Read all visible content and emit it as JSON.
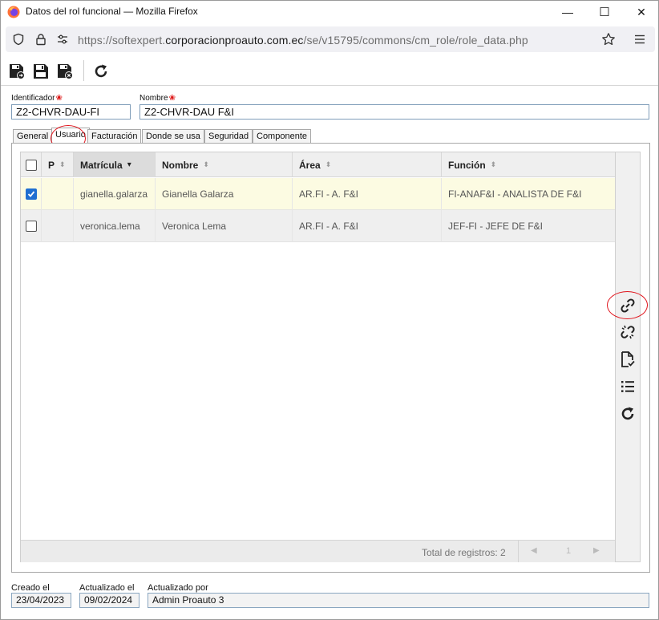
{
  "window": {
    "title": "Datos del rol funcional — Mozilla Firefox",
    "minimize_glyph": "—",
    "maximize_glyph": "☐",
    "close_glyph": "✕"
  },
  "urlbar": {
    "prefix": "https://softexpert.",
    "domain": "corporacionproauto.com.ec",
    "path": "/se/v15795/commons/cm_role/role_data.php"
  },
  "toolbar": {
    "icons": [
      "save-new-icon",
      "save-icon",
      "save-close-icon",
      "refresh-icon"
    ]
  },
  "form": {
    "id_label": "Identificador",
    "id_value": "Z2-CHVR-DAU-FI",
    "name_label": "Nombre",
    "name_value": "Z2-CHVR-DAU F&I",
    "required_mark": "❀"
  },
  "tabs": [
    {
      "label": "General"
    },
    {
      "label": "Usuario"
    },
    {
      "label": "Facturación"
    },
    {
      "label": "Donde se usa"
    },
    {
      "label": "Seguridad"
    },
    {
      "label": "Componente"
    }
  ],
  "grid": {
    "headers": {
      "p": "P",
      "matricula": "Matrícula",
      "nombre": "Nombre",
      "area": "Área",
      "funcion": "Función"
    },
    "rows": [
      {
        "checked": true,
        "matricula": "gianella.galarza",
        "nombre": "Gianella Galarza",
        "area": "AR.FI - A. F&I",
        "funcion": "FI-ANAF&I - ANALISTA DE F&I"
      },
      {
        "checked": false,
        "matricula": "veronica.lema",
        "nombre": "Veronica Lema",
        "area": "AR.FI - A. F&I",
        "funcion": "JEF-FI - JEFE DE F&I"
      }
    ],
    "footer": {
      "total": "Total de registros: 2",
      "page": "1"
    }
  },
  "sidebar": {
    "icons": [
      "link-icon",
      "unlink-icon",
      "document-check-icon",
      "list-icon",
      "refresh-icon"
    ]
  },
  "meta": {
    "created_label": "Creado el",
    "created_value": "23/04/2023",
    "updated_label": "Actualizado el",
    "updated_value": "09/02/2024",
    "updated_by_label": "Actualizado por",
    "updated_by_value": "Admin Proauto 3"
  },
  "colors": {
    "selected_row": "#fcfbe2",
    "accent_check": "#1f6fd1",
    "annotation": "#e0141c"
  }
}
